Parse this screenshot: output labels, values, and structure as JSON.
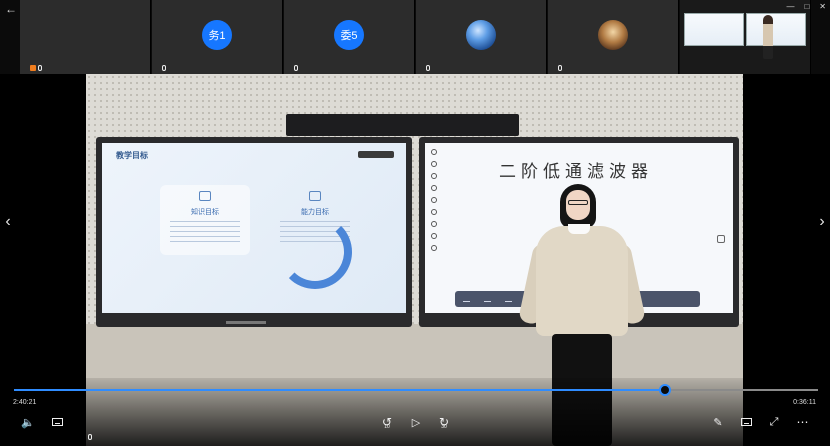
{
  "participants": [
    {
      "avatar_text": "",
      "label": "",
      "kind": "screen-share"
    },
    {
      "avatar_text": "务1",
      "label": "",
      "kind": "text"
    },
    {
      "avatar_text": "委5",
      "label": "",
      "kind": "text"
    },
    {
      "avatar_text": "",
      "label": "",
      "kind": "sea"
    },
    {
      "avatar_text": "",
      "label": "",
      "kind": "room"
    },
    {
      "avatar_text": "",
      "label": "",
      "kind": "doll"
    }
  ],
  "board": {
    "slide_title": "教学目标",
    "card_knowledge_title": "知识目标",
    "card_skill_title": "能力目标",
    "handwriting": "二阶低通滤波器"
  },
  "player": {
    "elapsed": "2:40:21",
    "total": "0:36:11",
    "progress": 0.81,
    "back_seconds": "10",
    "forward_seconds": "30"
  },
  "icons": {
    "volume": "volume-icon",
    "subtitle": "subtitle-icon",
    "back": "rewind-10-icon",
    "play": "play-icon",
    "forward": "forward-30-icon",
    "edit": "pen-icon",
    "screen": "screen-icon",
    "fullscreen": "fullscreen-icon",
    "more": "more-icon"
  },
  "colors": {
    "accent": "#2f8cff",
    "avatar_blue": "#1677ff"
  }
}
